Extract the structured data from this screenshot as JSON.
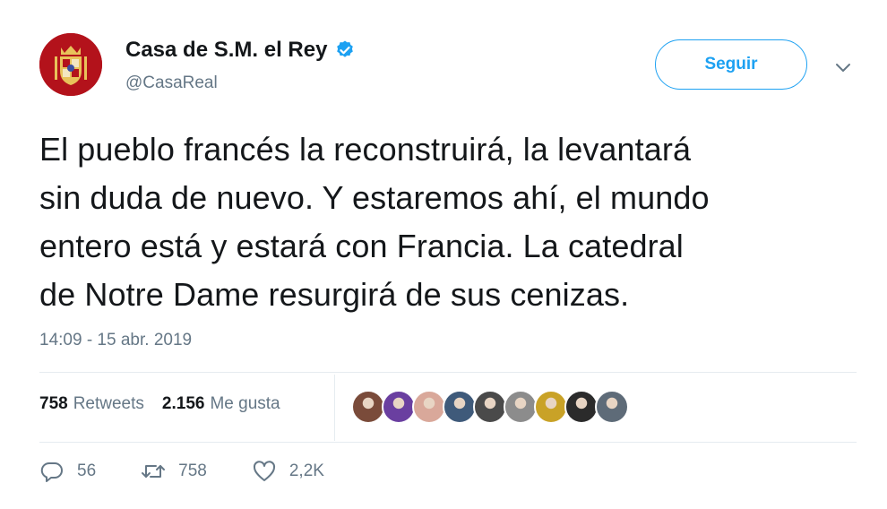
{
  "user": {
    "display_name": "Casa de S.M. el Rey",
    "handle": "@CasaReal",
    "verified_icon": "verified-badge-icon",
    "avatar_color": "#b3121b"
  },
  "follow_button": {
    "label": "Seguir"
  },
  "tweet": {
    "text": "El pueblo francés la reconstruirá, la levantará\nsin duda de nuevo. Y estaremos ahí, el mundo\nentero está y estará con Francia. La catedral\nde Notre Dame resurgirá de sus cenizas.",
    "timestamp": "14:09 - 15 abr. 2019"
  },
  "stats": {
    "retweets_count": "758",
    "retweets_label": "Retweets",
    "likes_count": "2.156",
    "likes_label": "Me gusta"
  },
  "likers": [
    "#7a4b3a",
    "#6a3fa0",
    "#d9a89a",
    "#3f5a7a",
    "#4a4a4a",
    "#8c8c8c",
    "#c9a227",
    "#2b2b2b",
    "#5e6b78"
  ],
  "actions": {
    "replies": "56",
    "retweets": "758",
    "likes": "2,2K"
  },
  "colors": {
    "accent": "#1da1f2",
    "muted": "#657786",
    "text": "#14171a",
    "border": "#e6ecf0"
  }
}
